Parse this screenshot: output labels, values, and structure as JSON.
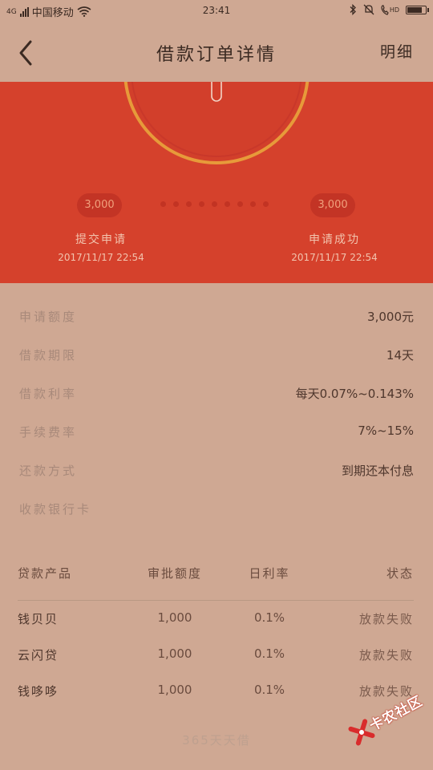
{
  "status_bar": {
    "network": "4G",
    "carrier": "中国移动",
    "time": "23:41",
    "hd": "HD",
    "battery_level": 0.85
  },
  "nav": {
    "title": "借款订单详情",
    "detail_link": "明细"
  },
  "hero": {
    "colors": {
      "bg": "#d5412c",
      "ring": "#e79a3a"
    },
    "steps": [
      {
        "amount": "3,000",
        "label": "提交申请",
        "date": "2017/11/17 22:54"
      },
      {
        "amount": "3,000",
        "label": "申请成功",
        "date": "2017/11/17 22:54"
      }
    ]
  },
  "info": [
    {
      "key": "申请额度",
      "value": "3,000元"
    },
    {
      "key": "借款期限",
      "value": "14天"
    },
    {
      "key": "借款利率",
      "value": "每天0.07%~0.143%"
    },
    {
      "key": "手续费率",
      "value": "7%~15%"
    },
    {
      "key": "还款方式",
      "value": "到期还本付息"
    },
    {
      "key": "收款银行卡",
      "value": ""
    }
  ],
  "table": {
    "headers": [
      "贷款产品",
      "审批额度",
      "日利率",
      "状态"
    ],
    "rows": [
      [
        "钱贝贝",
        "1,000",
        "0.1%",
        "放款失败"
      ],
      [
        "云闪贷",
        "1,000",
        "0.1%",
        "放款失败"
      ],
      [
        "钱哆哆",
        "1,000",
        "0.1%",
        "放款失败"
      ]
    ]
  },
  "footer_hint": "365天天借",
  "watermark": "卡农社区"
}
